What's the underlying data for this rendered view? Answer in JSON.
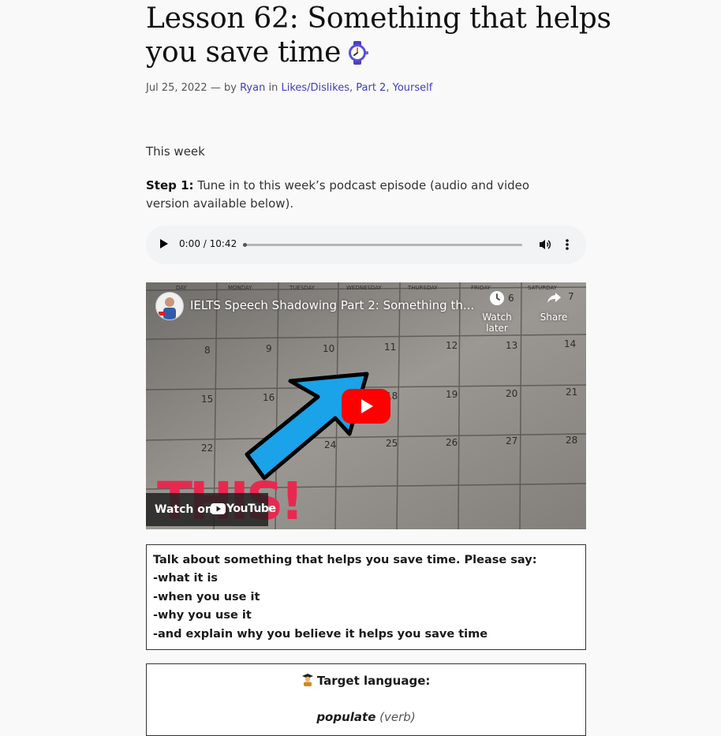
{
  "article": {
    "title": "Lesson 62: Something that helps you save time",
    "title_icon": "wristwatch-icon",
    "date": "Jul 25, 2022",
    "separator": "—",
    "by_label": "by",
    "author": "Ryan",
    "in_label": "in",
    "categories": [
      "Likes/Dislikes",
      "Part 2",
      "Yourself"
    ],
    "intro": "This week",
    "step1_label": "Step 1:",
    "step1_text": "Tune in to this week’s podcast episode (audio and video version available below)."
  },
  "audio_player": {
    "time": "0:00 / 10:42",
    "progress": 0.0
  },
  "video": {
    "title": "IELTS Speech Shadowing Part 2: Something th...",
    "watch_later_label": "Watch later",
    "share_label": "Share",
    "watch_on_label": "Watch on",
    "youtube_label": "YouTube",
    "thumbnail_text": "THIS!",
    "weekdays": [
      "DAY",
      "MONDAY",
      "TUESDAY",
      "WEDNESDAY",
      "THURSDAY",
      "FRIDAY",
      "SATURDAY"
    ],
    "calendar_numbers": [
      "6",
      "7",
      "8",
      "9",
      "10",
      "11",
      "12",
      "13",
      "14",
      "15",
      "16",
      "18",
      "19",
      "20",
      "21",
      "22",
      "24",
      "25",
      "26",
      "27",
      "28"
    ],
    "colors": {
      "arrow": "#1aa3e8",
      "play": "#ff0000",
      "thumbnail_text": "#e8294f"
    }
  },
  "prompt_box": {
    "lines": [
      "Talk about something that helps you save time. Please say:",
      "-what it is",
      "-when you use it",
      "-why you use it",
      "-and explain why you believe it helps you save time"
    ]
  },
  "target_box": {
    "icon": "student-icon",
    "heading": "Target language:",
    "word": "populate",
    "pos": "(verb)"
  }
}
